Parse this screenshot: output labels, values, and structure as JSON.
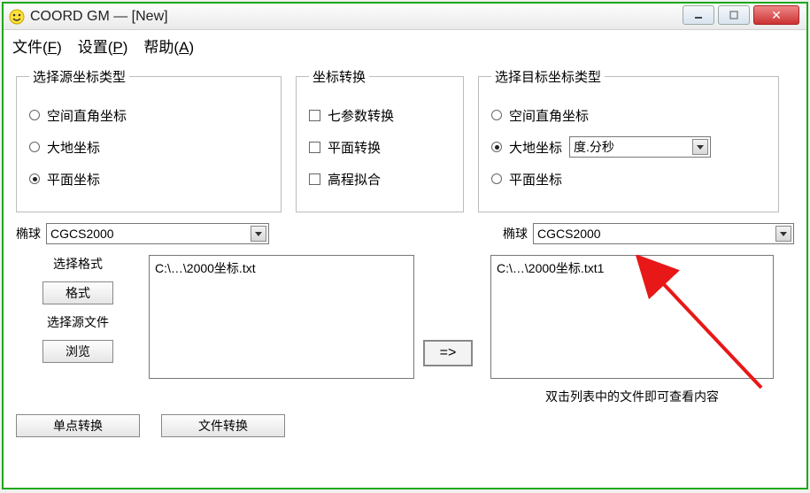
{
  "window": {
    "title": "COORD GM — [New]"
  },
  "menu": {
    "file": "文件(",
    "file_u": "F",
    "file_end": ")",
    "settings": "设置(",
    "settings_u": "P",
    "settings_end": ")",
    "help": "帮助(",
    "help_u": "A",
    "help_end": ")"
  },
  "source_group": {
    "legend": "选择源坐标类型",
    "opt1": "空间直角坐标",
    "opt2": "大地坐标",
    "opt3": "平面坐标",
    "selected": 3
  },
  "trans_group": {
    "legend": "坐标转换",
    "chk1": "七参数转换",
    "chk2": "平面转换",
    "chk3": "高程拟合"
  },
  "target_group": {
    "legend": "选择目标坐标类型",
    "opt1": "空间直角坐标",
    "opt2": "大地坐标",
    "opt3": "平面坐标",
    "selected": 2,
    "format_select": "度.分秒"
  },
  "ellipsoid": {
    "label": "椭球",
    "source_value": "CGCS2000",
    "target_value": "CGCS2000"
  },
  "left_panel": {
    "format_label": "选择格式",
    "format_btn": "格式",
    "source_file_label": "选择源文件",
    "browse_btn": "浏览",
    "list_item": "C:\\…\\2000坐标.txt"
  },
  "arrow_btn": "=>",
  "right_panel": {
    "list_item": "C:\\…\\2000坐标.txt1",
    "hint": "双击列表中的文件即可查看内容"
  },
  "bottom": {
    "single_btn": "单点转换",
    "file_btn": "文件转换"
  }
}
